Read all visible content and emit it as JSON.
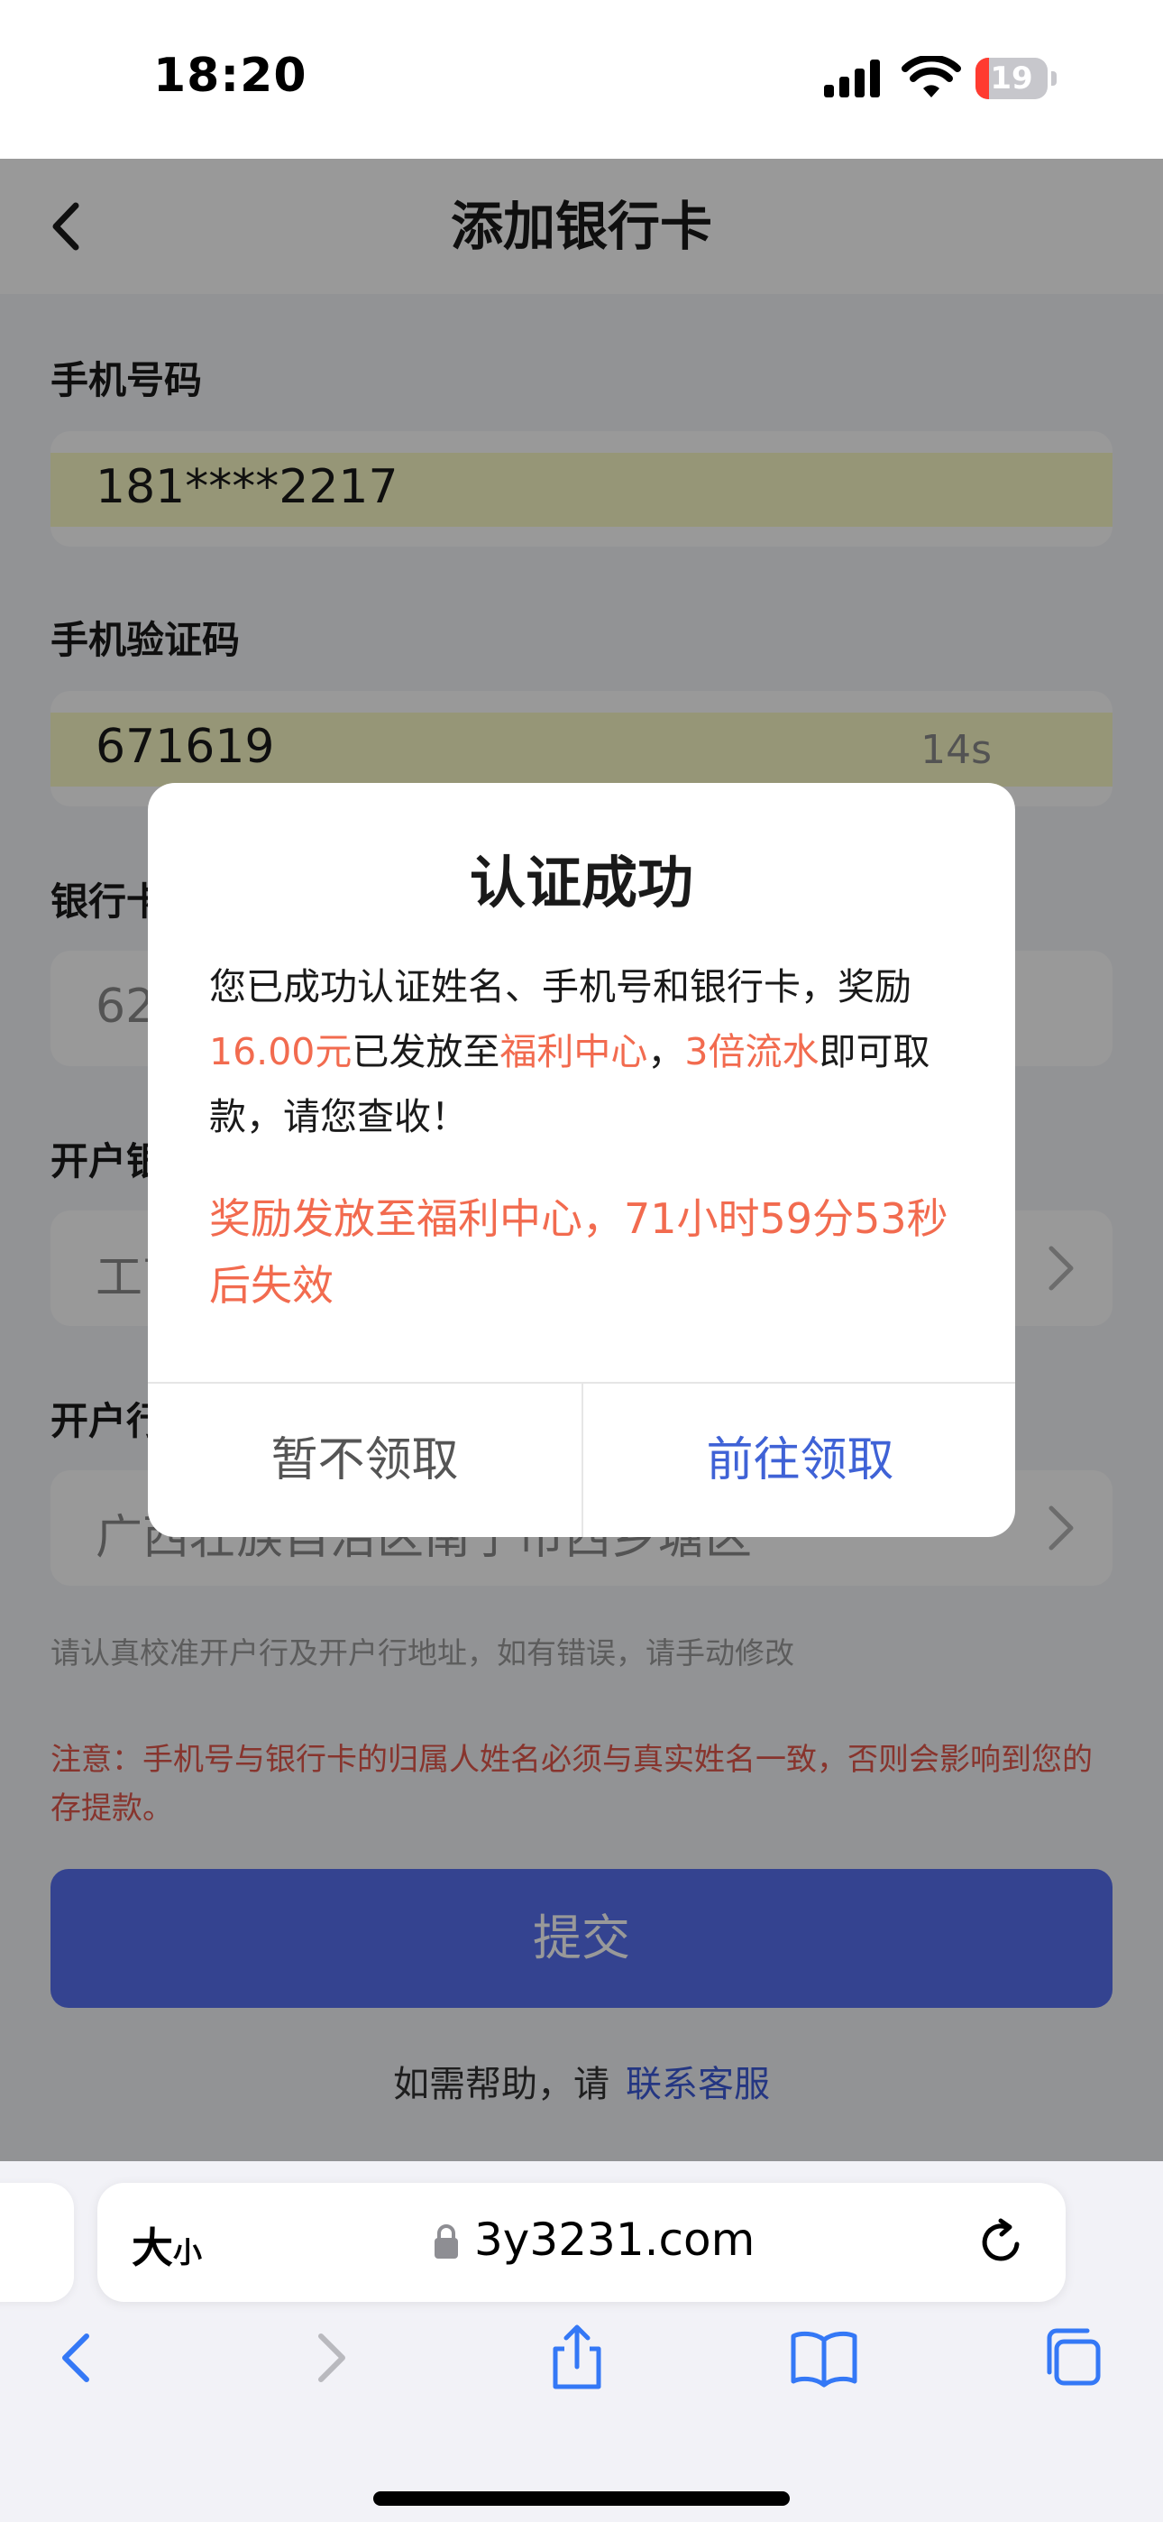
{
  "status_bar": {
    "time": "18:20",
    "battery_level": "19"
  },
  "page": {
    "title": "添加银行卡",
    "fields": {
      "phone": {
        "label": "手机号码",
        "value": "181****2217"
      },
      "code": {
        "label": "手机验证码",
        "value": "671619",
        "countdown": "14s"
      },
      "card": {
        "label": "银行卡号",
        "value": "6212"
      },
      "bank": {
        "label": "开户银行",
        "value": "工商银行"
      },
      "branch": {
        "label": "开户行地址",
        "value": "广西壮族自治区南宁市西乡塘区"
      }
    },
    "hint": "请认真校准开户行及开户行地址，如有错误，请手动修改",
    "warning": "注意：手机号与银行卡的归属人姓名必须与真实姓名一致，否则会影响到您的存提款。",
    "submit_label": "提交",
    "help_prefix": "如需帮助，请",
    "help_link": "联系客服"
  },
  "dialog": {
    "title": "认证成功",
    "msg_part1": "您已成功认证姓名、手机号和银行卡，奖励",
    "msg_amount": "16.00元",
    "msg_part2": "已发放至",
    "msg_center": "福利中心",
    "msg_part3": "，",
    "msg_turnover": "3倍流水",
    "msg_part4": "即可取款，请您查收！",
    "expiry": "奖励发放至福利中心，71小时59分53秒后失效",
    "decline_label": "暂不领取",
    "accept_label": "前往领取"
  },
  "browser": {
    "text_size_big": "大",
    "text_size_small": "小",
    "url": "3y3231.com"
  },
  "colors": {
    "accent_blue": "#5871f0",
    "highlight_orange": "#f26b4f",
    "warning_red": "#e2584b",
    "battery_low": "#ff3b30"
  }
}
